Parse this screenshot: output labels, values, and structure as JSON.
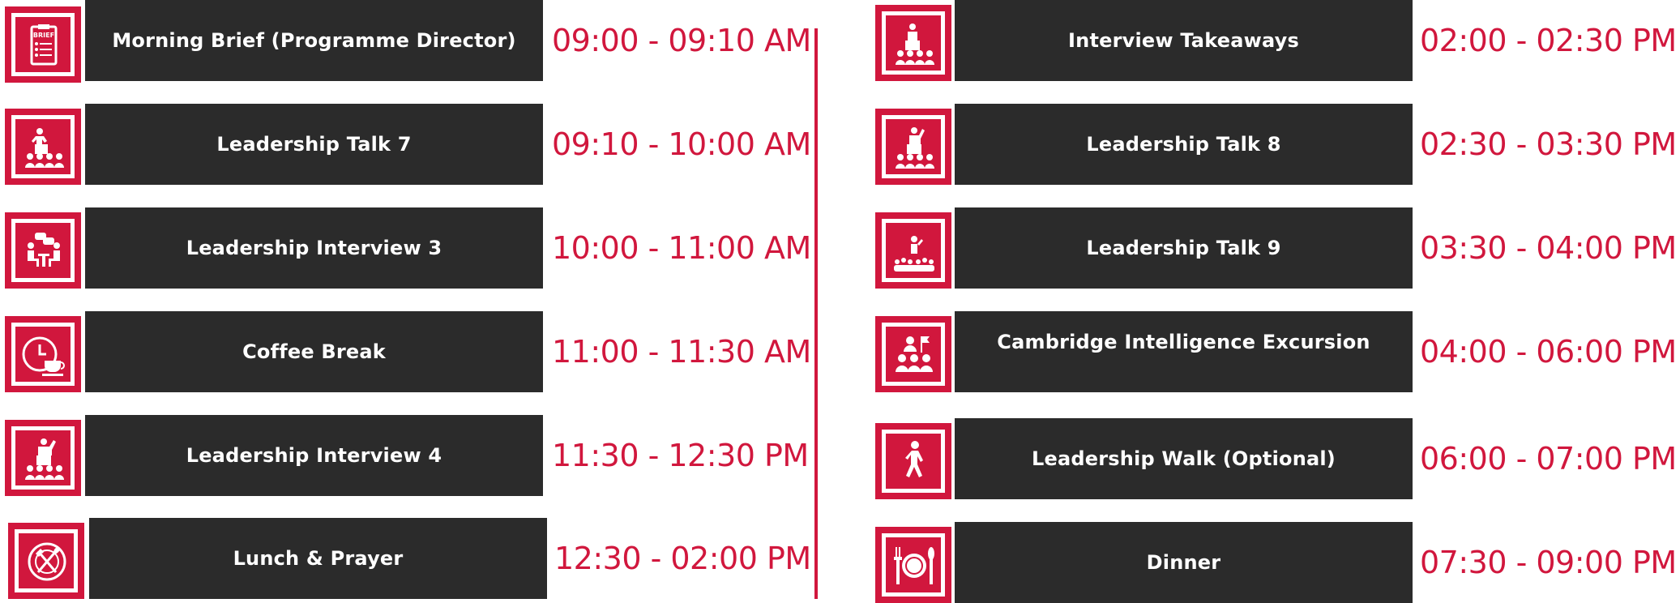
{
  "accent_color": "#d1173d",
  "bar_color": "#2b2b2b",
  "left_column": [
    {
      "title": "Morning Brief (Programme Director)",
      "time": "09:00 - 09:10 AM",
      "icon": "clipboard-brief-icon"
    },
    {
      "title": "Leadership Talk 7",
      "time": "09:10 - 10:00 AM",
      "icon": "speaker-podium-icon"
    },
    {
      "title": "Leadership Interview 3",
      "time": "10:00 - 11:00 AM",
      "icon": "interview-chat-icon"
    },
    {
      "title": "Coffee Break",
      "time": "11:00 - 11:30 AM",
      "icon": "clock-coffee-icon"
    },
    {
      "title": "Leadership Interview 4",
      "time": "11:30 - 12:30 PM",
      "icon": "speaker-podium-icon"
    },
    {
      "title": "Lunch & Prayer",
      "time": "12:30 - 02:00 PM",
      "icon": "plate-cutlery-icon"
    }
  ],
  "right_column": [
    {
      "title": "Interview Takeaways",
      "time": "02:00 - 02:30 PM",
      "icon": "speaker-podium-icon"
    },
    {
      "title": "Leadership Talk 8",
      "time": "02:30 - 03:30 PM",
      "icon": "speaker-podium-icon"
    },
    {
      "title": "Leadership Talk 9",
      "time": "03:30 - 04:00 PM",
      "icon": "speaker-crowd-icon"
    },
    {
      "title": "Cambridge Intelligence Excursion",
      "time": "04:00 - 06:00 PM",
      "icon": "group-flag-icon"
    },
    {
      "title": "Leadership Walk (Optional)",
      "time": "06:00 - 07:00 PM",
      "icon": "walking-person-icon"
    },
    {
      "title": "Dinner",
      "time": "07:30 - 09:00 PM",
      "icon": "dinner-plate-icon"
    }
  ]
}
